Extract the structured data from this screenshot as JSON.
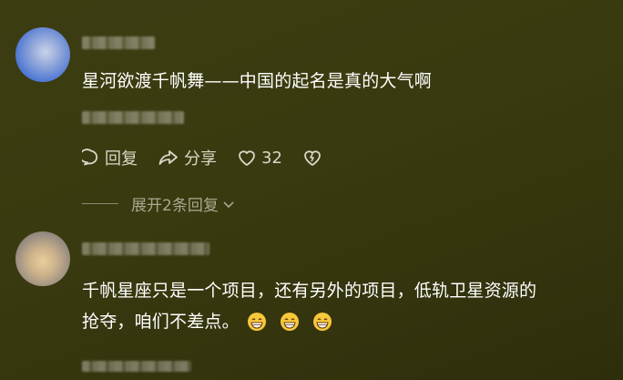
{
  "comments": [
    {
      "text": "星河欲渡千帆舞——中国的起名是真的大气啊",
      "actions": {
        "reply_label": "回复",
        "share_label": "分享",
        "like_count": "32"
      },
      "expand_label": "展开2条回复"
    },
    {
      "text_line1": "千帆星座只是一个项目，还有另外的项目，低轨卫星资源的",
      "text_line2": "抢夺，咱们不差点。",
      "emoji_icon": "grinning-face-icon"
    }
  ],
  "colors": {
    "background": "#3b3b11",
    "secondary_text": "#d8d8c8",
    "muted_text": "#a8a890"
  }
}
